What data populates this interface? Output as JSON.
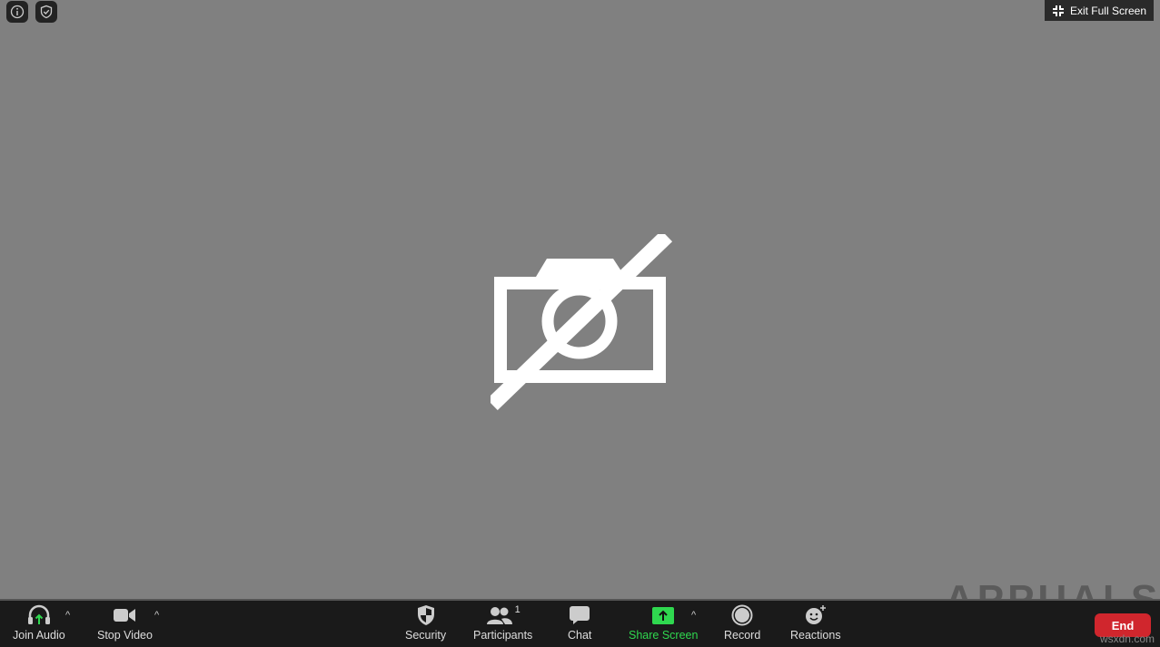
{
  "top": {
    "exit_full_screen": "Exit Full Screen"
  },
  "toolbar": {
    "join_audio": "Join Audio",
    "stop_video": "Stop Video",
    "security": "Security",
    "participants": "Participants",
    "participant_count": "1",
    "chat": "Chat",
    "share_screen": "Share Screen",
    "record": "Record",
    "reactions": "Reactions",
    "end": "End"
  },
  "colors": {
    "accent_green": "#2fd84f",
    "end_red": "#d0262d",
    "background": "#808080",
    "toolbar": "#1a1a1a"
  },
  "watermark": {
    "logo": "APPUALS",
    "site": "wsxdn.com"
  }
}
